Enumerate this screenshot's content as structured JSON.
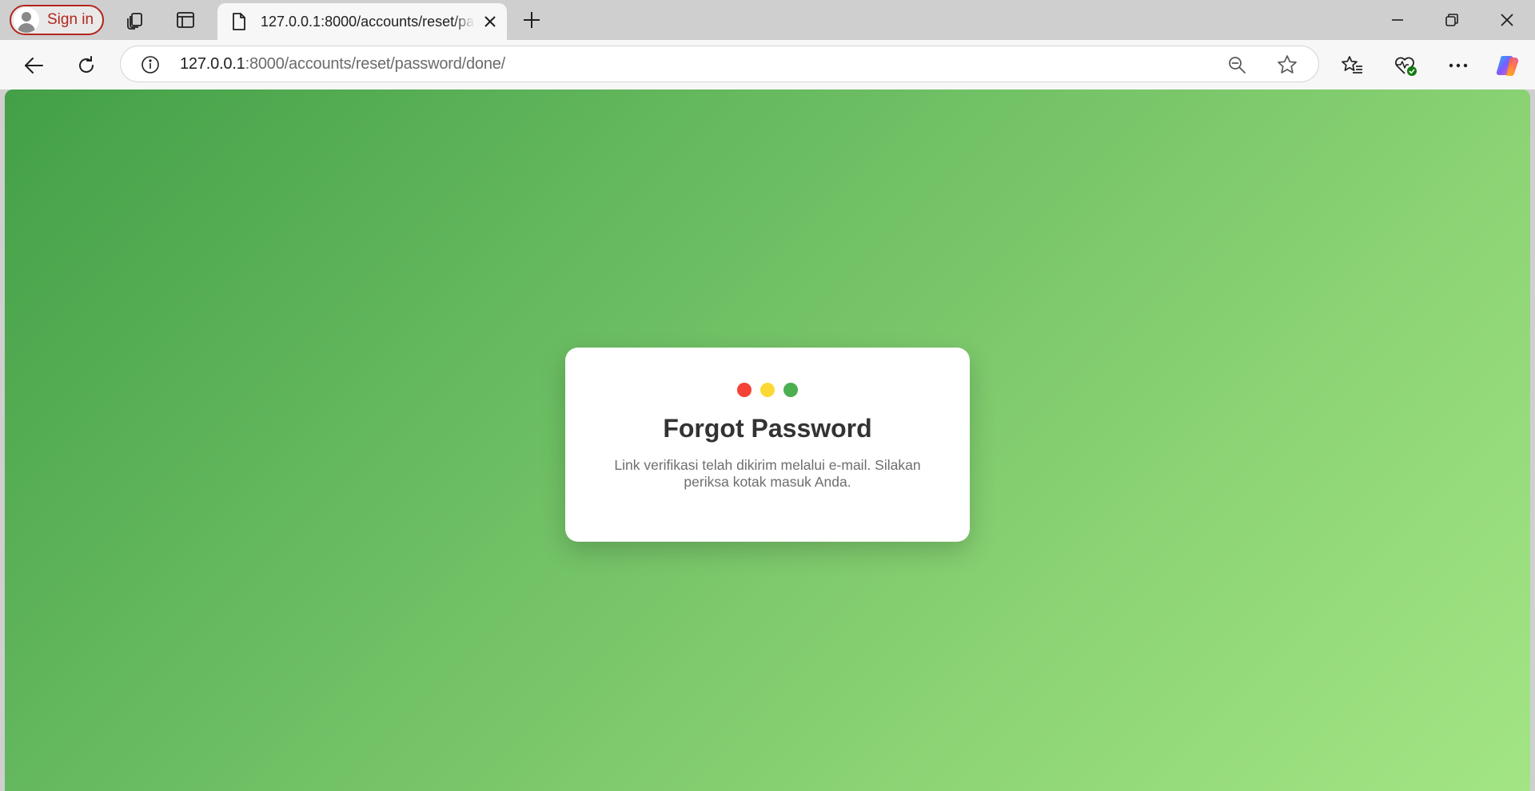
{
  "browser": {
    "signin_label": "Sign in",
    "tab": {
      "title": "127.0.0.1:8000/accounts/reset/password/done/"
    },
    "address": {
      "host": "127.0.0.1",
      "rest": ":8000/accounts/reset/password/done/"
    }
  },
  "page": {
    "background_colors": [
      "#43a047",
      "#a3e585"
    ],
    "card": {
      "dots": [
        {
          "name": "red",
          "color": "#f44336"
        },
        {
          "name": "yellow",
          "color": "#fdd835"
        },
        {
          "name": "green",
          "color": "#4caf50"
        }
      ],
      "title": "Forgot Password",
      "message": "Link verifikasi telah dikirim melalui e-mail. Silakan periksa kotak masuk Anda."
    }
  }
}
